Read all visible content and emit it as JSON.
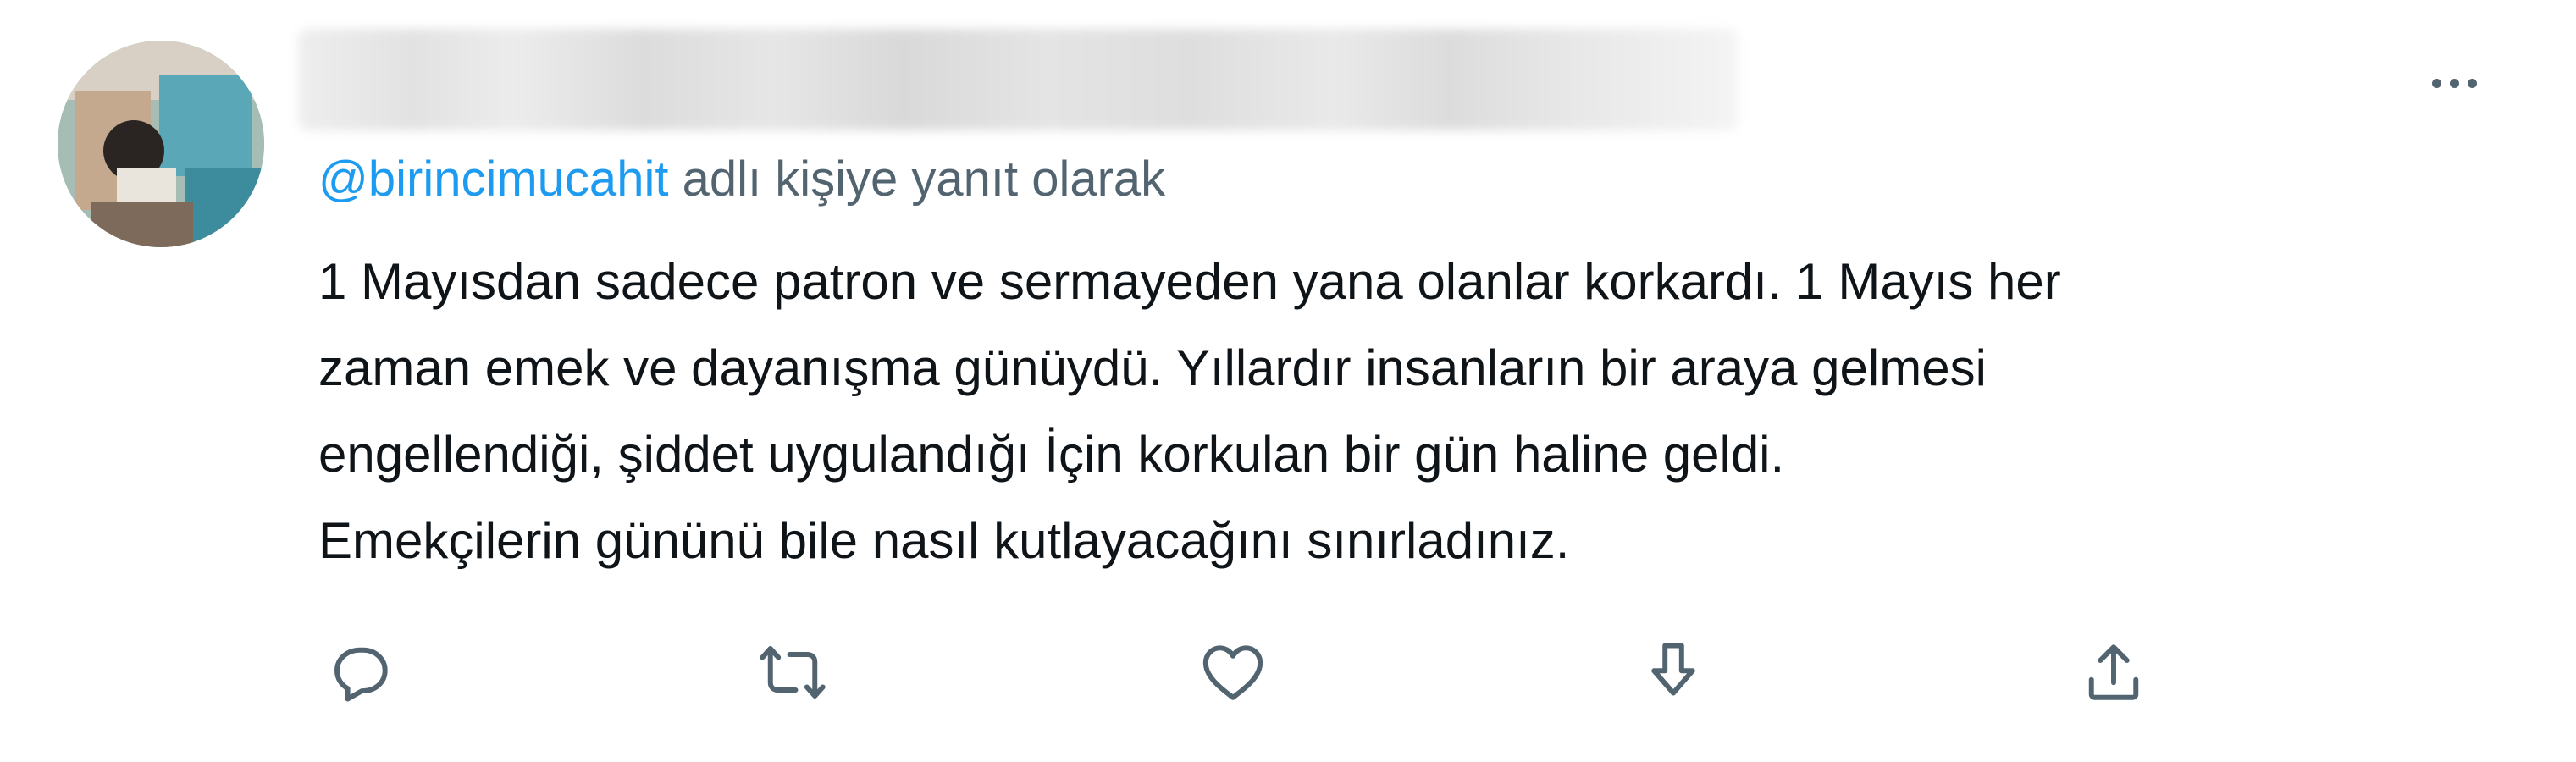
{
  "tweet": {
    "reply_handle": "@birincimucahit",
    "reply_suffix": " adlı kişiye yanıt olarak",
    "text_lines": [
      "1 Mayısdan sadece patron ve sermayeden yana olanlar korkardı. 1 Mayıs her",
      "zaman emek ve dayanışma günüydü. Yıllardır insanların bir araya gelmesi",
      "engellendiği, şiddet uygulandığı İçin korkulan bir gün haline geldi.",
      "Emekçilerin gününü bile nasıl kutlayacağını sınırladınız."
    ]
  },
  "actions": [
    {
      "icon": "reply-icon"
    },
    {
      "icon": "retweet-icon"
    },
    {
      "icon": "like-icon"
    },
    {
      "icon": "download-icon"
    },
    {
      "icon": "share-icon"
    }
  ],
  "colors": {
    "accent": "#1d9bf0",
    "text": "#0f1419",
    "secondary": "#536471"
  }
}
